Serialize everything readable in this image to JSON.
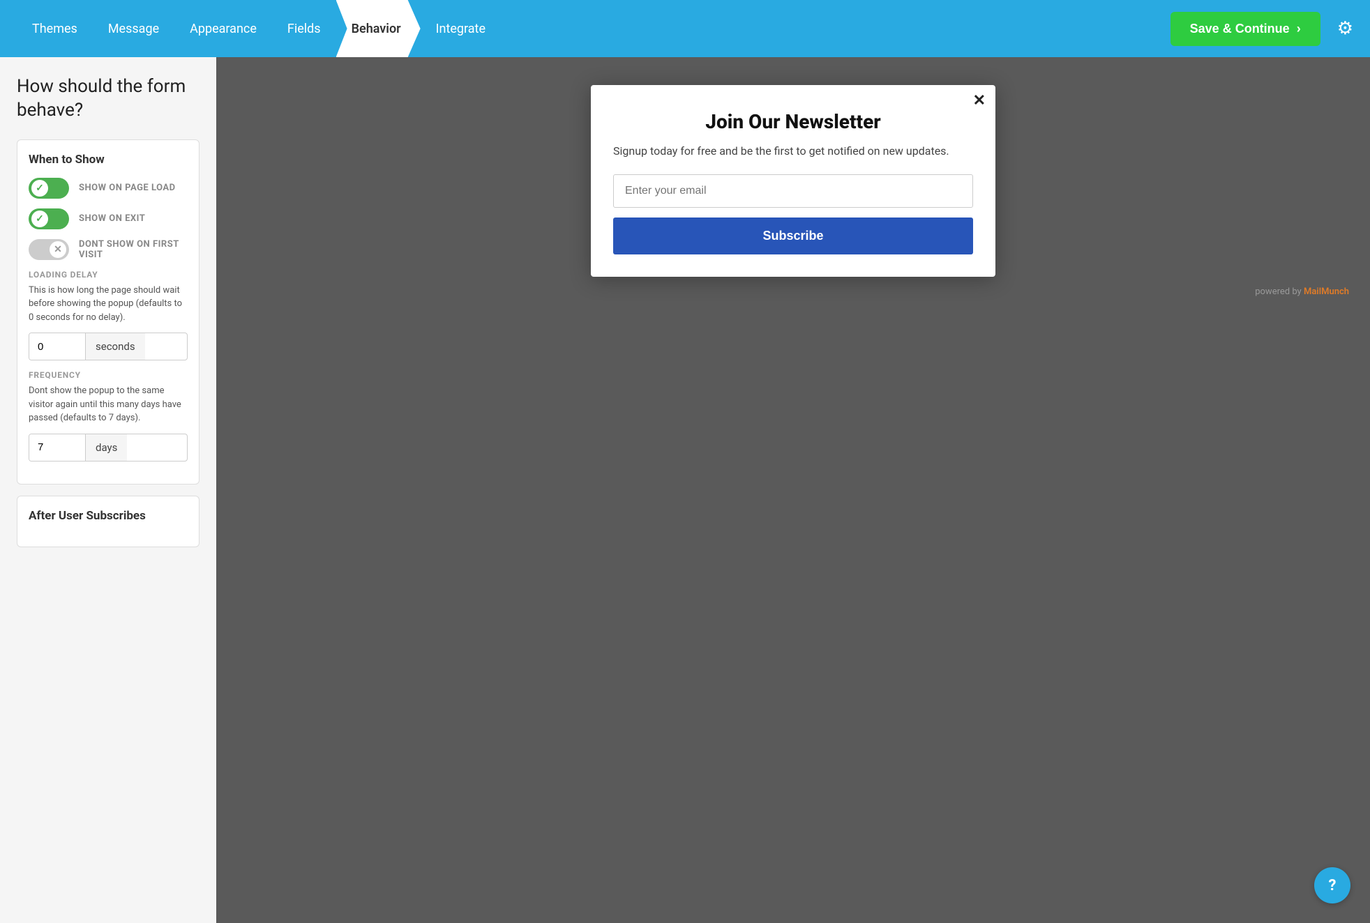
{
  "nav": {
    "items": [
      {
        "id": "themes",
        "label": "Themes",
        "active": false
      },
      {
        "id": "message",
        "label": "Message",
        "active": false
      },
      {
        "id": "appearance",
        "label": "Appearance",
        "active": false
      },
      {
        "id": "fields",
        "label": "Fields",
        "active": false
      },
      {
        "id": "behavior",
        "label": "Behavior",
        "active": true
      },
      {
        "id": "integrate",
        "label": "Integrate",
        "active": false
      }
    ],
    "save_label": "Save & Continue",
    "save_chevron": "›"
  },
  "left": {
    "page_question": "How should the form behave?",
    "when_to_show": {
      "title": "When to Show",
      "toggles": [
        {
          "id": "page-load",
          "label": "SHOW ON PAGE LOAD",
          "on": true
        },
        {
          "id": "exit",
          "label": "SHOW ON EXIT",
          "on": true
        },
        {
          "id": "first-visit",
          "label": "DONT SHOW ON FIRST VISIT",
          "on": false
        }
      ],
      "loading_delay": {
        "sub_label": "LOADING DELAY",
        "desc": "This is how long the page should wait before showing the popup (defaults to 0 seconds for no delay).",
        "value": "0",
        "unit": "seconds"
      },
      "frequency": {
        "sub_label": "FREQUENCY",
        "desc": "Dont show the popup to the same visitor again until this many days have passed (defaults to 7 days).",
        "value": "7",
        "unit": "days"
      }
    },
    "after_user_subscribes": {
      "title": "After User Subscribes"
    }
  },
  "popup": {
    "title": "Join Our Newsletter",
    "desc": "Signup today for free and be the first to get notified on new updates.",
    "email_placeholder": "Enter your email",
    "subscribe_label": "Subscribe",
    "close_icon": "✕"
  },
  "powered_by": {
    "text": "powered by",
    "brand": "MailMunch"
  },
  "help": {
    "icon": "?"
  }
}
